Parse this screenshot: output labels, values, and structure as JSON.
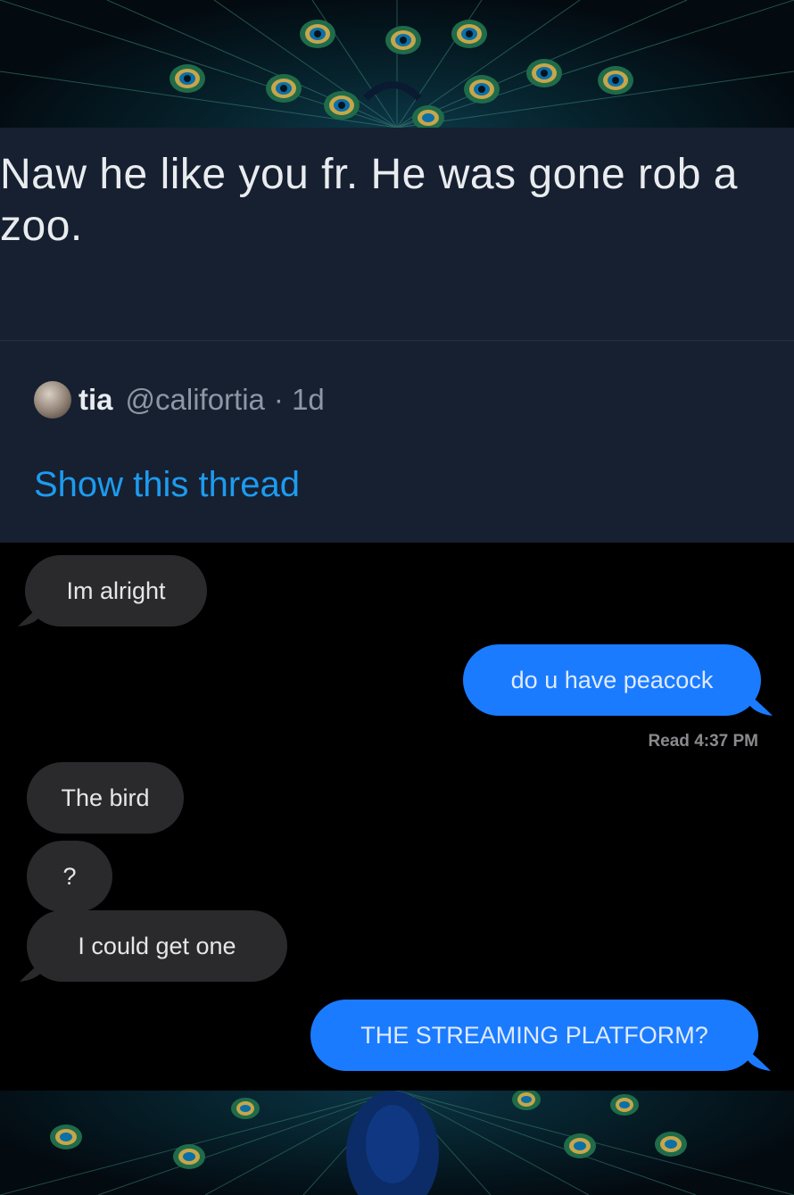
{
  "tweet": {
    "text": "Naw he like you fr. He was gone rob a zoo.",
    "author_name": "tia",
    "author_handle": "@califortia",
    "time": "· 1d",
    "show_thread": "Show this thread"
  },
  "messages": {
    "items": [
      {
        "from": "received",
        "text": "Im alright"
      },
      {
        "from": "sent",
        "text": "do u have peacock"
      },
      {
        "from": "received",
        "text": "The bird"
      },
      {
        "from": "received",
        "text": "?"
      },
      {
        "from": "received",
        "text": "I could get one"
      },
      {
        "from": "sent",
        "text": "THE STREAMING PLATFORM?"
      }
    ],
    "read_receipt": "Read 4:37 PM"
  },
  "colors": {
    "tweet_bg": "#172030",
    "link_blue": "#1d9bf0",
    "sent_bubble": "#1a7bff",
    "received_bubble": "#2a2a2c"
  }
}
